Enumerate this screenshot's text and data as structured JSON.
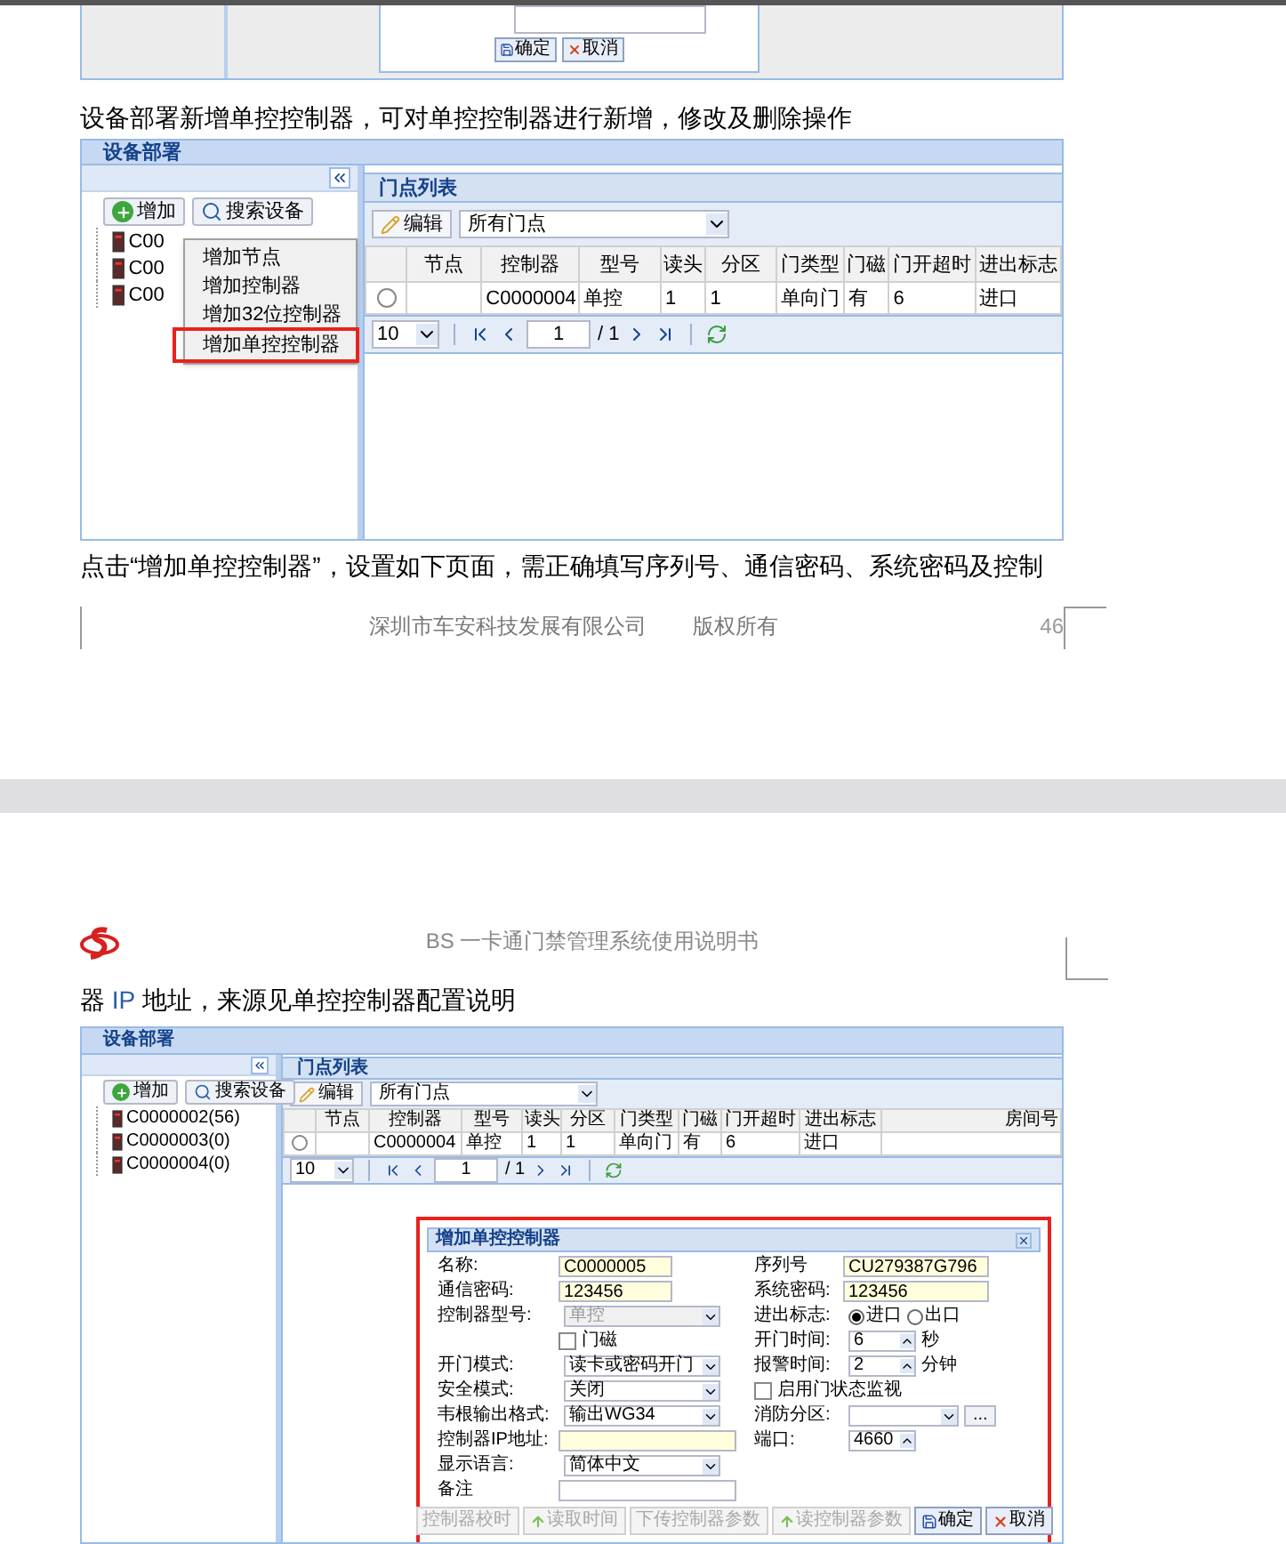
{
  "prev_screenshot": {
    "buttons": [
      {
        "label": "确定",
        "kind": "save"
      },
      {
        "label": "取消",
        "kind": "cancel"
      }
    ]
  },
  "page1": {
    "paragraph_1": "设备部署新增单控控制器，可对单控控制器进行新增，修改及删除操作",
    "screenshot": {
      "panel_title": "设备部署",
      "left": {
        "buttons": [
          {
            "label": "增加",
            "kind": "add"
          },
          {
            "label": "搜索设备",
            "kind": "search"
          }
        ],
        "tree": [
          {
            "label": "C00"
          },
          {
            "label": "C00"
          },
          {
            "label": "C00"
          }
        ],
        "menu": [
          {
            "label": "增加节点",
            "marked": false
          },
          {
            "label": "增加控制器",
            "marked": false
          },
          {
            "label": "增加32位控制器",
            "marked": false
          },
          {
            "label": "增加单控控制器",
            "marked": true
          }
        ]
      },
      "right": {
        "title": "门点列表",
        "edit_button": "编辑",
        "filter": "所有门点",
        "table": {
          "columns": [
            "节点",
            "控制器",
            "型号",
            "读头",
            "分区",
            "门类型",
            "门磁",
            "门开超时",
            "进出标志"
          ],
          "rows": [
            {
              "selected": false,
              "cells": [
                null,
                "C0000004",
                "单控",
                "1",
                "1",
                "单向门",
                "有",
                "6",
                "进口"
              ]
            }
          ]
        },
        "pager": {
          "page_size": "10",
          "page": "1",
          "total": "/ 1"
        }
      }
    },
    "paragraph_2": "点击“增加单控控制器”，设置如下页面，需正确填写序列号、通信密码、系统密码及控制",
    "footer": {
      "company": "深圳市车安科技发展有限公司",
      "rights": "版权所有",
      "page_number": "46"
    }
  },
  "page2": {
    "header": "BS 一卡通门禁管理系统使用说明书",
    "paragraph": [
      {
        "text": "器 ",
        "highlight": false
      },
      {
        "text": "IP",
        "highlight": true
      },
      {
        "text": " 地址，来源见单控控制器配置说明",
        "highlight": false
      }
    ],
    "screenshot": {
      "panel_title": "设备部署",
      "left": {
        "buttons": [
          {
            "label": "增加",
            "kind": "add"
          },
          {
            "label": "搜索设备",
            "kind": "search"
          }
        ],
        "tree": [
          {
            "label": "C0000002(56)"
          },
          {
            "label": "C0000003(0)"
          },
          {
            "label": "C0000004(0)"
          }
        ]
      },
      "right": {
        "title": "门点列表",
        "edit_button": "编辑",
        "filter": "所有门点",
        "table": {
          "columns": [
            "节点",
            "控制器",
            "型号",
            "读头",
            "分区",
            "门类型",
            "门磁",
            "门开超时",
            "进出标志",
            "房间号"
          ],
          "rows": [
            {
              "selected": false,
              "cells": [
                null,
                "C0000004",
                "单控",
                "1",
                "1",
                "单向门",
                "有",
                "6",
                "进口",
                null
              ]
            }
          ]
        },
        "pager": {
          "page_size": "10",
          "page": "1",
          "total": "/ 1"
        }
      },
      "dialog": {
        "title": "增加单控控制器",
        "marked": true,
        "rows": [
          {
            "left": {
              "kind": "text",
              "label": "名称:",
              "value": "C0000005",
              "required": true
            },
            "right": {
              "kind": "text",
              "label": "序列号",
              "value": "CU279387G796",
              "required": true
            }
          },
          {
            "left": {
              "kind": "text",
              "label": "通信密码:",
              "value": "123456",
              "required": true
            },
            "right": {
              "kind": "text",
              "label": "系统密码:",
              "value": "123456",
              "required": true
            }
          },
          {
            "left": {
              "kind": "select",
              "label": "控制器型号:",
              "value": "单控",
              "disabled": true
            },
            "right": {
              "kind": "radio",
              "label": "进出标志:",
              "options": [
                {
                  "label": "进口",
                  "selected": true
                },
                {
                  "label": "出口",
                  "selected": false
                }
              ]
            }
          },
          {
            "left": {
              "kind": "checkbox",
              "label": "门磁",
              "checked": false
            },
            "right": {
              "kind": "spin",
              "label": "开门时间:",
              "value": "6",
              "unit": "秒"
            }
          },
          {
            "left": {
              "kind": "select",
              "label": "开门模式:",
              "value": "读卡或密码开门",
              "disabled": false
            },
            "right": {
              "kind": "spin",
              "label": "报警时间:",
              "value": "2",
              "unit": "分钟"
            }
          },
          {
            "left": {
              "kind": "select",
              "label": "安全模式:",
              "value": "关闭",
              "disabled": false
            },
            "right": {
              "kind": "checkbox",
              "label": "启用门状态监视",
              "checked": false
            }
          },
          {
            "left": {
              "kind": "select",
              "label": "韦根输出格式:",
              "value": "输出WG34",
              "disabled": false
            },
            "right": {
              "kind": "select",
              "label": "消防分区:",
              "disabled": false,
              "button": "..."
            }
          },
          {
            "left": {
              "kind": "text",
              "label": "控制器IP地址:",
              "required": true,
              "wide": true
            },
            "right": {
              "kind": "spin",
              "label": "端口:",
              "value": "4660"
            }
          },
          {
            "left": {
              "kind": "select",
              "label": "显示语言:",
              "value": "简体中文",
              "disabled": false
            }
          },
          {
            "left": {
              "kind": "text",
              "label": "备注",
              "required": false,
              "wide": true
            }
          }
        ],
        "buttons": [
          {
            "label": "控制器校时",
            "disabled": true,
            "kind": "plain"
          },
          {
            "label": "读取时间",
            "disabled": true,
            "kind": "up"
          },
          {
            "label": "下传控制器参数",
            "disabled": true,
            "kind": "plain"
          },
          {
            "label": "读控制器参数",
            "disabled": true,
            "kind": "up"
          },
          {
            "label": "确定",
            "disabled": false,
            "kind": "save"
          },
          {
            "label": "取消",
            "disabled": false,
            "kind": "cancel"
          }
        ]
      }
    }
  }
}
